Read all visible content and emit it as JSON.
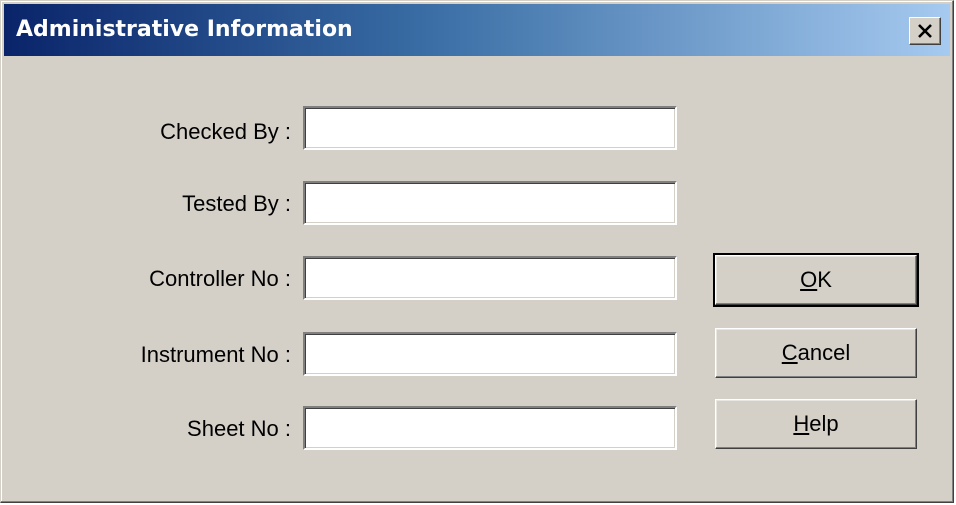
{
  "dialog": {
    "title": "Administrative Information"
  },
  "fields": [
    {
      "label": "Checked By :",
      "value": ""
    },
    {
      "label": "Tested By :",
      "value": ""
    },
    {
      "label": "Controller No :",
      "value": ""
    },
    {
      "label": "Instrument No :",
      "value": ""
    },
    {
      "label": "Sheet No :",
      "value": ""
    }
  ],
  "buttons": {
    "ok": {
      "mnemonic": "O",
      "rest": "K"
    },
    "cancel": {
      "mnemonic": "C",
      "rest": "ancel"
    },
    "help": {
      "mnemonic": "H",
      "rest": "elp"
    }
  },
  "icons": {
    "close": "close-icon"
  }
}
